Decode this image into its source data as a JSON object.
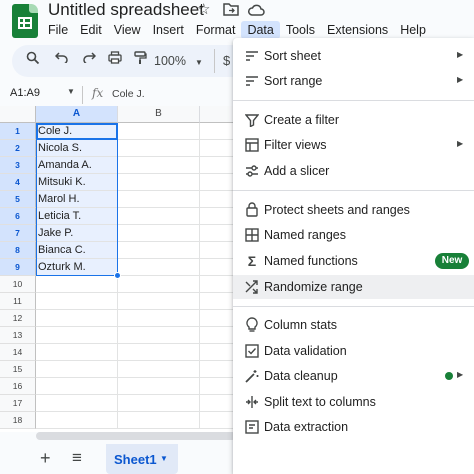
{
  "header": {
    "title": "Untitled spreadsheet",
    "icons": [
      "star-icon",
      "move-to-folder-icon",
      "cloud-status-icon"
    ]
  },
  "menubar": {
    "items": [
      "File",
      "Edit",
      "View",
      "Insert",
      "Format",
      "Data",
      "Tools",
      "Extensions",
      "Help"
    ],
    "active": "Data"
  },
  "toolbar": {
    "zoom": "100%",
    "currency": "$"
  },
  "formula_bar": {
    "name_box": "A1:A9",
    "fx": "fx",
    "value": "Cole J."
  },
  "grid": {
    "columns": [
      "A",
      "B"
    ],
    "selected_column": "A",
    "rows": [
      "1",
      "2",
      "3",
      "4",
      "5",
      "6",
      "7",
      "8",
      "9",
      "10",
      "11",
      "12",
      "13",
      "14",
      "15",
      "16",
      "17",
      "18"
    ],
    "selected_rows": 9,
    "column_a_values": [
      "Cole J.",
      "Nicola S.",
      "Amanda A.",
      "Mitsuki K.",
      "Marol H.",
      "Leticia T.",
      "Jake P.",
      "Bianca C.",
      "Ozturk M."
    ]
  },
  "sheets": {
    "tabs": [
      "Sheet1"
    ],
    "active": "Sheet1"
  },
  "data_menu": {
    "sort_sheet": "Sort sheet",
    "sort_range": "Sort range",
    "create_filter": "Create a filter",
    "filter_views": "Filter views",
    "add_slicer": "Add a slicer",
    "protect": "Protect sheets and ranges",
    "named_ranges": "Named ranges",
    "named_functions": "Named functions",
    "new_badge": "New",
    "randomize": "Randomize range",
    "column_stats": "Column stats",
    "data_validation": "Data validation",
    "data_cleanup": "Data cleanup",
    "split_text": "Split text to columns",
    "data_extraction": "Data extraction"
  },
  "colors": {
    "accent": "#1a73e8",
    "brand_green": "#188038",
    "selection_fill": "#e8f0fe",
    "menu_active": "#d3e3fd"
  }
}
